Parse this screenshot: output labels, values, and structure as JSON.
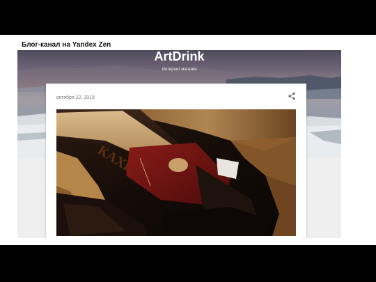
{
  "slide": {
    "title": "Блог-канал на Yandex Zen"
  },
  "blog": {
    "title": "ArtDrink",
    "description": "Интернет магазин"
  },
  "post": {
    "date": "октября 22, 2019",
    "image_alt": "Бутылки коньяка",
    "label_text": "КАХЕТ",
    "share_icon": "share-icon"
  },
  "colors": {
    "slide_background": "#ffffff",
    "frame_background": "#000000",
    "card_background": "#ffffff",
    "date_text": "#777777"
  }
}
